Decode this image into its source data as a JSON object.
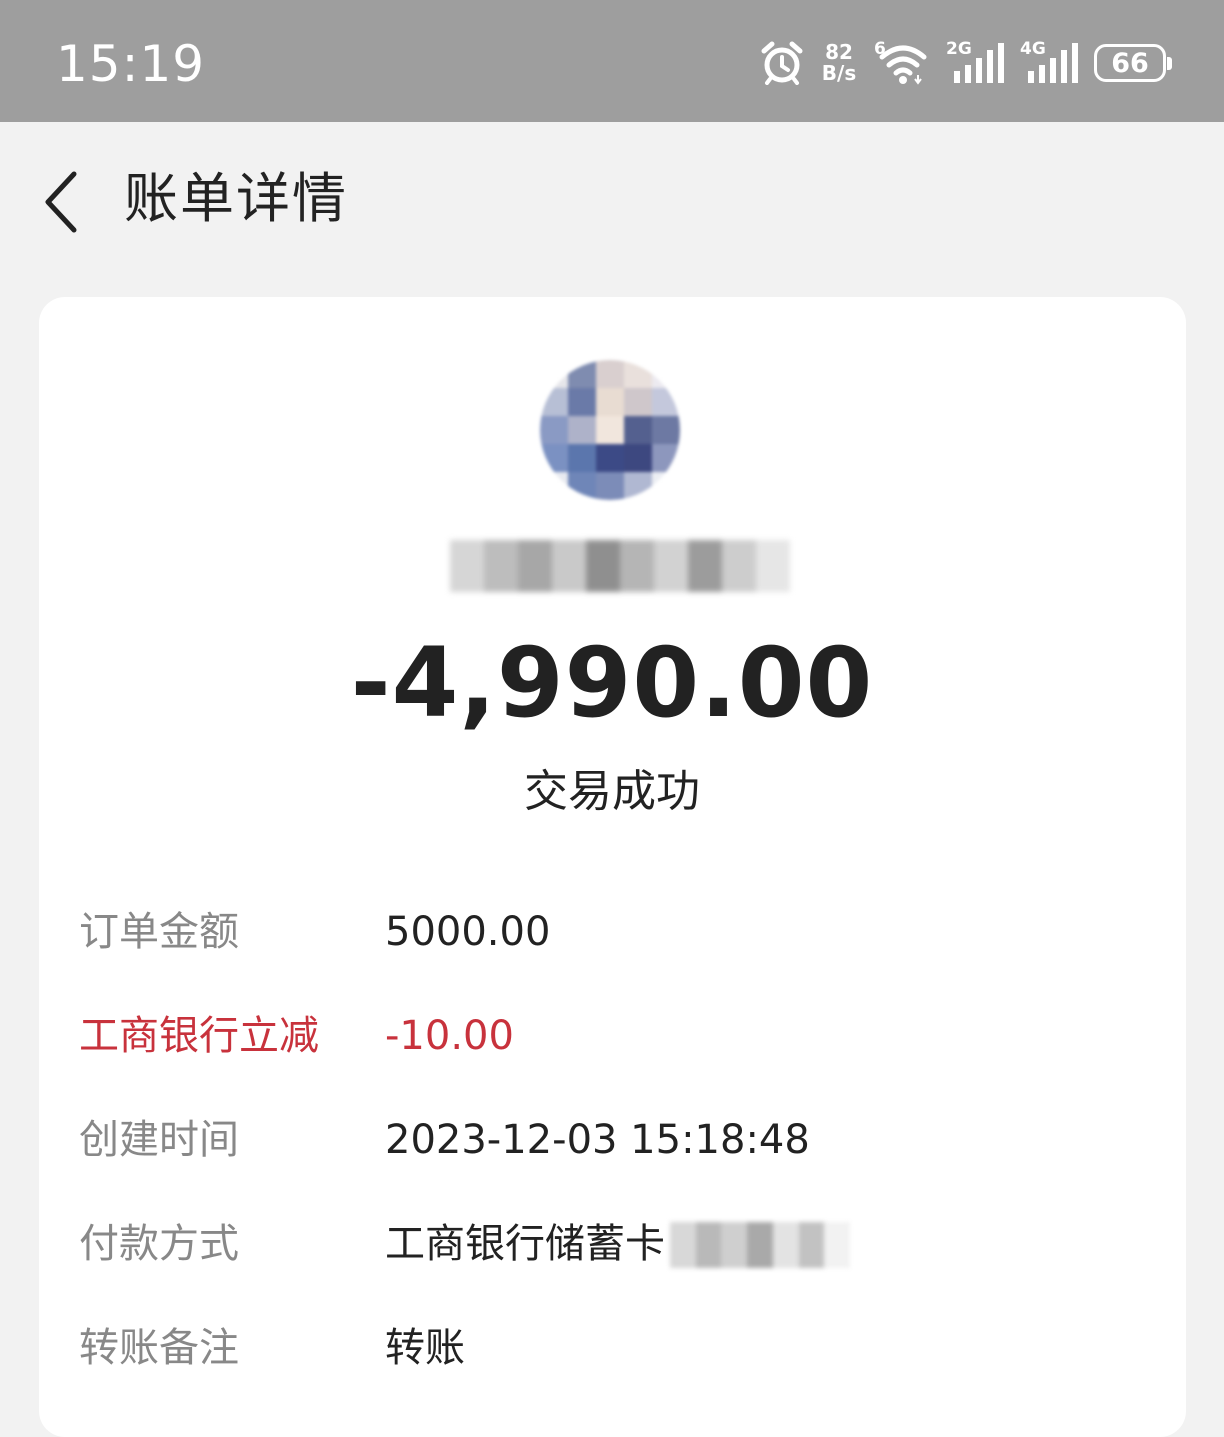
{
  "status_bar": {
    "time": "15:19",
    "net_speed_value": "82",
    "net_speed_unit": "B/s",
    "wifi_label": "6",
    "sim1_label": "2G",
    "sim2_label": "4G",
    "battery": "66",
    "icons": [
      "alarm-icon",
      "wifi-icon",
      "signal-icon",
      "signal-icon",
      "battery-icon"
    ]
  },
  "header": {
    "title": "账单详情",
    "back_icon": "chevron-left-icon"
  },
  "transaction": {
    "amount": "-4,990.00",
    "status": "交易成功"
  },
  "details": [
    {
      "label": "订单金额",
      "value": "5000.00"
    },
    {
      "label": "工商银行立减",
      "value": "-10.00"
    },
    {
      "label": "创建时间",
      "value": "2023-12-03 15:18:48"
    },
    {
      "label": "付款方式",
      "value": "工商银行储蓄卡"
    },
    {
      "label": "转账备注",
      "value": "转账"
    }
  ],
  "colors": {
    "discount": "#c8323c",
    "status_bar_bg": "#9e9e9e",
    "page_bg": "#f2f2f2"
  }
}
